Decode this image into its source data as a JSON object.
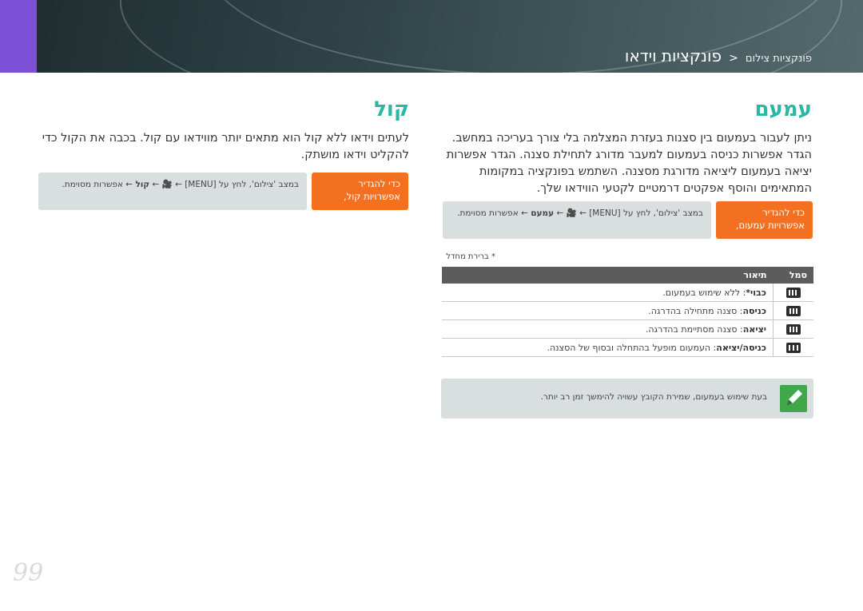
{
  "header": {
    "breadcrumb_parent": "פונקציות צילום",
    "separator": "<",
    "title": "פונקציות וידאו"
  },
  "fader": {
    "title": "עמעם",
    "paragraph": "ניתן לעבור בעמעום בין סצנות בעזרת המצלמה בלי צורך בעריכה במחשב. הגדר אפשרות כניסה בעמעום למעבר מדורג לתחילת סצנה. הגדר אפשרות יציאה בעמעום ליציאה מדורגת מסצנה. השתמש בפונקציה במקומות המתאימים והוסף אפקטים דרמטיים לקטעי הווידאו שלך.",
    "howto": {
      "badge": "כדי להגדיר אפשרויות עמעום,",
      "steps_pre": "במצב 'צילום', לחץ על [MENU] ←",
      "steps_icon": "🎥",
      "steps_arrow": "←",
      "steps_bold": "עמעם",
      "steps_post": "← אפשרות מסוימת."
    },
    "footnote": "* ברירת מחדל",
    "table": {
      "col_icon": "סמל",
      "col_desc": "תיאור",
      "rows": [
        {
          "icon": "fader-off-icon",
          "name": "כבוי*",
          "desc": ": ללא שימוש בעמעום."
        },
        {
          "icon": "fader-in-icon",
          "name": "כניסה",
          "desc": ": סצנה מתחילה בהדרגה."
        },
        {
          "icon": "fader-out-icon",
          "name": "יציאה",
          "desc": ": סצנה מסתיימת בהדרגה."
        },
        {
          "icon": "fader-in-out-icon",
          "name": "כניסה/יציאה",
          "desc": ": העמעום מופעל בהתחלה ובסוף של הסצנה."
        }
      ]
    },
    "tip": "בעת שימוש בעמעום, שמירת הקובץ עשויה להימשך זמן רב יותר."
  },
  "voice": {
    "title": "קול",
    "paragraph": "לעתים וידאו ללא קול הוא מתאים יותר מווידאו עם קול. בכבה את הקול כדי להקליט וידאו מושתק.",
    "howto": {
      "badge": "כדי להגדיר אפשרויות קול,",
      "steps_pre": "במצב 'צילום', לחץ על [MENU] ←",
      "steps_icon": "🎥",
      "steps_arrow": "←",
      "steps_bold": "קול",
      "steps_post": "← אפשרות מסוימת."
    }
  },
  "page_number": "99",
  "colors": {
    "accent": "#2bb7a3",
    "badge": "#f37021",
    "header": "#2f4347",
    "tab": "#7b4fd6"
  }
}
